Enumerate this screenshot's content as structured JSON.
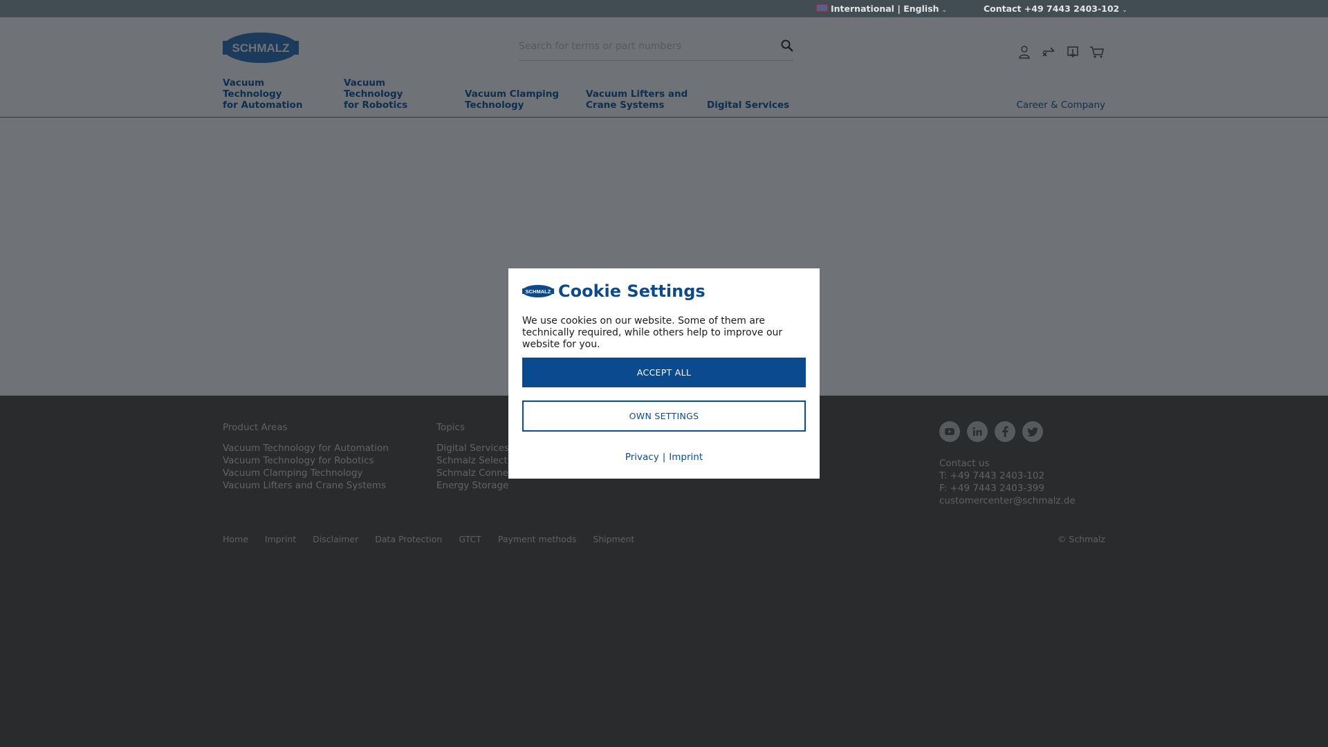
{
  "topbar": {
    "language": "International | English",
    "contact": "Contact +49 7443 2403-102"
  },
  "header": {
    "logo_text": "SCHMALZ",
    "search": {
      "placeholder": "Search for terms or part numbers"
    },
    "icons": [
      "user-icon",
      "compare-icon",
      "notepad-icon",
      "cart-icon"
    ]
  },
  "nav": {
    "items": [
      {
        "line1": "Vacuum Technology",
        "line2": "for Automation"
      },
      {
        "line1": "Vacuum Technology",
        "line2": "for Robotics"
      },
      {
        "line1": "Vacuum Clamping",
        "line2": "Technology"
      },
      {
        "line1": "Vacuum Lifters and",
        "line2": "Crane Systems"
      },
      {
        "line1": "",
        "line2": "Digital Services"
      }
    ],
    "career": "Career & Company"
  },
  "footer": {
    "product_areas": {
      "heading": "Product Areas",
      "links": [
        "Vacuum Technology for Automation",
        "Vacuum Technology for Robotics",
        "Vacuum Clamping Technology",
        "Vacuum Lifters and Crane Systems"
      ]
    },
    "topics": {
      "heading": "Topics",
      "links": [
        "Digital Services",
        "Schmalz Select",
        "Schmalz Connect",
        "Energy Storage"
      ]
    },
    "social": [
      "youtube-icon",
      "linkedin-icon",
      "facebook-icon",
      "twitter-icon"
    ],
    "contact": {
      "heading": "Contact us",
      "phone": "T: +49 7443 2403-102",
      "fax": "F: +49 7443 2403-399",
      "email": "customercenter@schmalz.de"
    },
    "bottom_links": [
      "Home",
      "Imprint",
      "Disclaimer",
      "Data Protection",
      "GTCT",
      "Payment methods",
      "Shipment"
    ],
    "copyright": "© Schmalz"
  },
  "cookie_modal": {
    "title": "Cookie Settings",
    "text": "We use cookies on our website. Some of them are technically required, while others help to improve our website for you.",
    "accept_label": "ACCEPT ALL",
    "own_settings_label": "OWN SETTINGS",
    "privacy_link": "Privacy",
    "separator": "|",
    "imprint_link": "Imprint"
  },
  "colors": {
    "brand_blue": "#0b4a8f",
    "overlay_page": "#6f7377",
    "footer_bg": "#292b2d"
  }
}
